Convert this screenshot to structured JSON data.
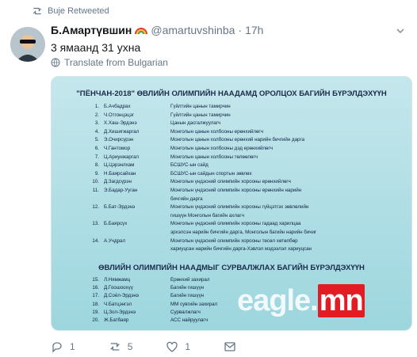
{
  "retweet": {
    "label": "Buje Retweeted",
    "icon": "retweet-icon"
  },
  "author": {
    "name": "Б.Амартүвшин",
    "handle": "@amartuvshinba",
    "dot": "·",
    "time": "17h",
    "emoji_icon": "rainbow-icon"
  },
  "tweet": {
    "text": "3 ямаанд 31 ухна",
    "translate_label": "Translate from Bulgarian"
  },
  "media": {
    "title_1": "\"ПЁНЧАН-2018\" ӨВЛИЙН ОЛИМПИЙН НААДАМД ОРОЛЦОХ БАГИЙН БҮРЭЛДЭХҮҮН",
    "title_2": "ӨВЛИЙН ОЛИМПИЙН НААДМЫГ СУРВАЛЖЛАХ БАГИЙН БҮРЭЛДЭХҮҮН",
    "team": [
      {
        "num": "1.",
        "name": "Б.Ачбадрах",
        "role": "Гүйлтийн цанын тамирчин"
      },
      {
        "num": "2.",
        "name": "Ч.Отгонцэцэг",
        "role": "Гүйлтийн цанын тамирчин"
      },
      {
        "num": "3.",
        "name": "Х.Хаш-Эрдэнэ",
        "role": "Цанын дасгалжуулагч"
      },
      {
        "num": "4.",
        "name": "Д.Хишигжаргал",
        "role": "Монголын цанын холбооны ерөнхийлөгч"
      },
      {
        "num": "5.",
        "name": "Э.Очирсүрэн",
        "role": "Монголын цанын холбооны ерөнхий нарийн бичгийн дарга"
      },
      {
        "num": "6.",
        "name": "Ч.Гантомор",
        "role": "Монголын цанын холбооны дэд ерөнхийлөгч"
      },
      {
        "num": "7.",
        "name": "Ц.Ариунжаргал",
        "role": "Монголын цанын холбооны төлөөлөгч"
      },
      {
        "num": "8.",
        "name": "Ц.Цэрэнлхам",
        "role": "БСШУС-ын сайд"
      },
      {
        "num": "9.",
        "name": "Н.Баярсайхан",
        "role": "БСШУС-ын сайдын спортын зөвлөх"
      },
      {
        "num": "10.",
        "name": "Д.Загдсүрэн",
        "role": "Монголын үндэсний олимпийн хорооны ерөнхийлөгч"
      },
      {
        "num": "11.",
        "name": "Э.Бадар-Ууган",
        "role": "Монголын үндэсний олимпийн хорооны ерөнхийн нарийн"
      },
      {
        "num": "",
        "name": "",
        "role": "бичгийн дарга"
      },
      {
        "num": "12.",
        "name": "Б.Бат-Эрдэнэ",
        "role": "Монголын үндэсний олимпийн хорооны гүйцэтгэх зөвлөлийн"
      },
      {
        "num": "",
        "name": "",
        "role": "гишүүн Монголын багийн ахлагч"
      },
      {
        "num": "13.",
        "name": "Б.Баярсүх",
        "role": "Монголын үндэсний олимпийн хорооны гадаад харилцаа"
      },
      {
        "num": "",
        "name": "",
        "role": "эрхэлсэн нарийн бичгийн дарга, Монголын багийн нарийн бичиг"
      },
      {
        "num": "14.",
        "name": "А.Учдрал",
        "role": "Монголын үндэсний олимпийн хорооны төсөл хөтөлбөр"
      },
      {
        "num": "",
        "name": "",
        "role": "хариуцсан нарийн бичгийн дарга-Хэвлэл мэдээлэл хариуцсан"
      }
    ],
    "press": [
      {
        "num": "15.",
        "name": "Л.Нямжамц",
        "role": "Ерөнхий захирал"
      },
      {
        "num": "16.",
        "name": "Д.Гоошоохүү",
        "role": "Багийн гишүүн"
      },
      {
        "num": "17.",
        "name": "Д.Соёл-Эрдэнэ",
        "role": "Багийн гишүүн"
      },
      {
        "num": "18.",
        "name": "Ч.Батцэнгэл",
        "role": "ММ сувгийн захирал"
      },
      {
        "num": "19.",
        "name": "Ц.Зол-Эрдэнэ",
        "role": "Сурвалжлагч"
      },
      {
        "num": "20.",
        "name": "Ж.Батбаяр",
        "role": "АСС найруулагч"
      }
    ],
    "watermark_text": "eagle.",
    "watermark_accent": "mn"
  },
  "actions": {
    "reply": {
      "icon": "reply-icon",
      "count": "1"
    },
    "retweet": {
      "icon": "retweet-icon",
      "count": "5"
    },
    "like": {
      "icon": "heart-icon",
      "count": "1"
    },
    "dm": {
      "icon": "message-icon"
    }
  }
}
